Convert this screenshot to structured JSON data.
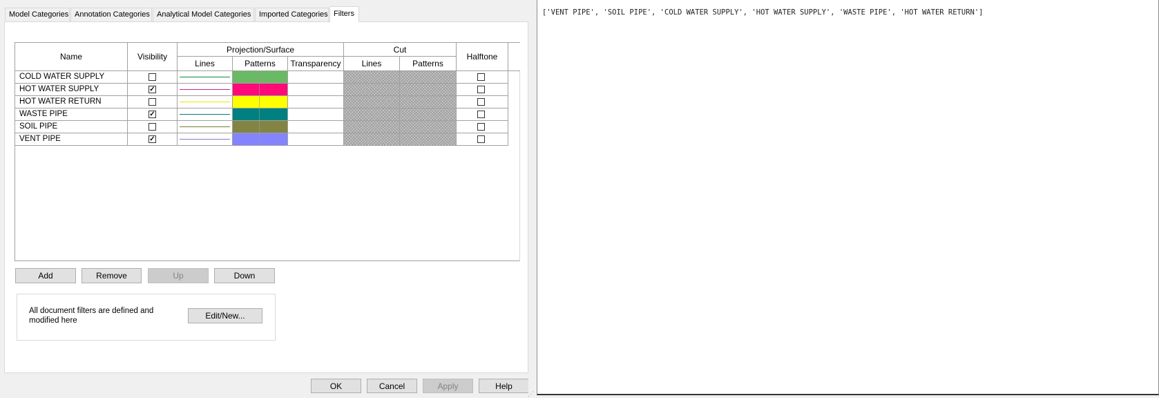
{
  "tabs": [
    {
      "label": "Model Categories"
    },
    {
      "label": "Annotation Categories"
    },
    {
      "label": "Analytical Model Categories"
    },
    {
      "label": "Imported Categories"
    },
    {
      "label": "Filters",
      "active": true
    }
  ],
  "grid": {
    "headers": {
      "name": "Name",
      "visibility": "Visibility",
      "projection_surface": "Projection/Surface",
      "proj_lines": "Lines",
      "proj_patterns": "Patterns",
      "proj_transparency": "Transparency",
      "cut": "Cut",
      "cut_lines": "Lines",
      "cut_patterns": "Patterns",
      "halftone": "Halftone"
    },
    "rows": [
      {
        "name": "COLD WATER SUPPLY",
        "visible": false,
        "line_color": "#0c8c3c",
        "pattern_color": "#6ab964",
        "halftone": false
      },
      {
        "name": "HOT WATER SUPPLY",
        "visible": true,
        "line_color": "#c8287a",
        "pattern_color": "#ff0a78",
        "halftone": false
      },
      {
        "name": "HOT WATER RETURN",
        "visible": false,
        "line_color": "#e6e600",
        "pattern_color": "#ffff00",
        "halftone": false
      },
      {
        "name": "WASTE PIPE",
        "visible": true,
        "line_color": "#007a80",
        "pattern_color": "#00807e",
        "halftone": false
      },
      {
        "name": "SOIL PIPE",
        "visible": false,
        "line_color": "#7a7a30",
        "pattern_color": "#838344",
        "halftone": false
      },
      {
        "name": "VENT PIPE",
        "visible": true,
        "line_color": "#8a7ad0",
        "pattern_color": "#8484ff",
        "halftone": false
      }
    ]
  },
  "buttons": {
    "add": "Add",
    "remove": "Remove",
    "up": "Up",
    "down": "Down",
    "edit_new": "Edit/New...",
    "ok": "OK",
    "cancel": "Cancel",
    "apply": "Apply",
    "help": "Help"
  },
  "info": {
    "line1": "All document filters are defined and",
    "line2": "modified here"
  },
  "output": {
    "text": "['VENT PIPE', 'SOIL PIPE', 'COLD WATER SUPPLY', 'HOT WATER SUPPLY', 'WASTE PIPE', 'HOT WATER RETURN']"
  },
  "colors": {
    "window_bg": "#f0f0f0",
    "cut_hatch": "#c8c8c8",
    "grid_border": "#a0a0a0"
  }
}
